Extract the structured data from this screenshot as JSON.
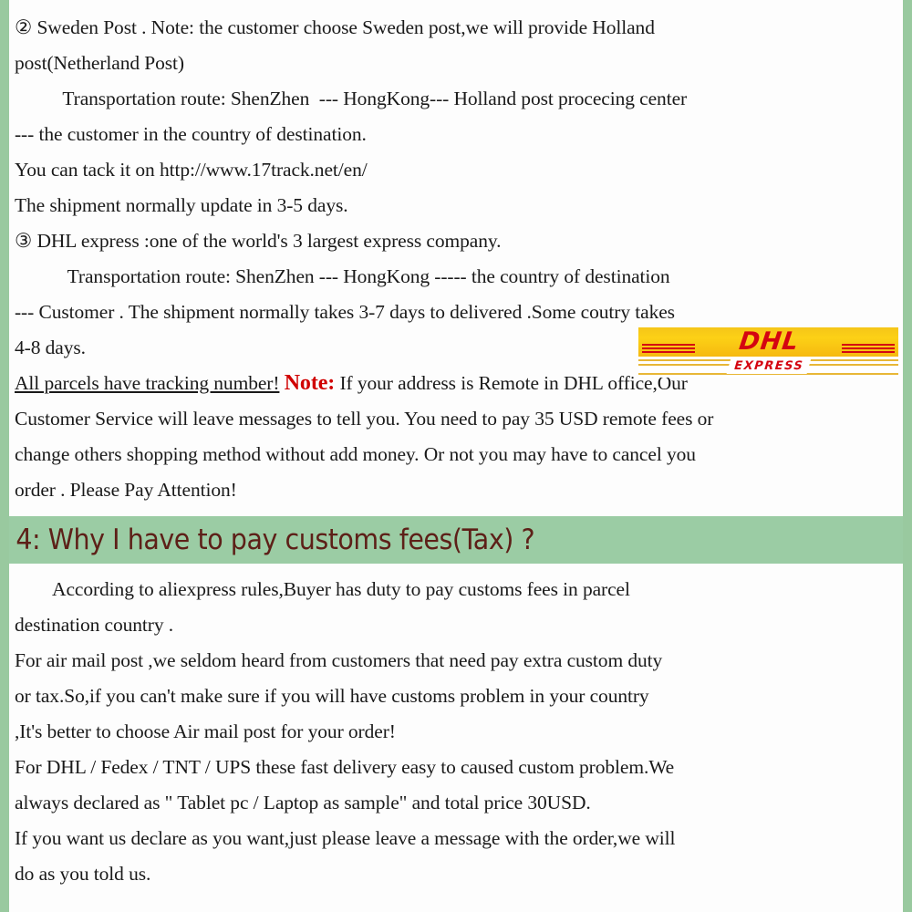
{
  "colors": {
    "page_background": "#fdfdfd",
    "side_border_green": "#99c99f",
    "heading_band_green": "#9bcca4",
    "heading_text": "#5d2018",
    "note_red": "#d00000",
    "dhl_yellow": "#fcd116",
    "dhl_red": "#d40511",
    "body_text": "#1a1a1a"
  },
  "section_shipping": {
    "sweden": {
      "line1": "② Sweden Post . Note: the customer choose Sweden post,we will provide Holland",
      "line2": "post(Netherland Post)",
      "line3": "          Transportation route: ShenZhen  --- HongKong--- Holland post procecing center",
      "line4": "--- the customer in the country of destination.",
      "line5": "You can tack it on http://www.17track.net/en/",
      "line6": "The shipment normally update in 3-5 days."
    },
    "dhl": {
      "line1": "③ DHL express :one of the world's 3 largest express company.",
      "line2": "           Transportation route: ShenZhen --- HongKong ----- the country of destination",
      "line3": "--- Customer . The shipment normally takes 3-7 days to delivered .Some coutry takes",
      "line4": "4-8 days."
    },
    "tracking_note": {
      "underlined_part": "All parcels have tracking number!",
      "note_label": "Note:",
      "note_rest": " If your address is Remote in DHL office,Our",
      "line2": "Customer Service will leave messages to tell you. You need to pay 35 USD remote fees or",
      "line3": "change others shopping method without add money. Or not you may have to cancel you",
      "line4": "order . Please Pay Attention!"
    }
  },
  "dhl_logo": {
    "wordmark": "DHL",
    "subtitle": "EXPRESS"
  },
  "section_customs": {
    "heading": "4: Why I have to pay customs fees(Tax) ?",
    "line1": "        According to aliexpress rules,Buyer has duty to pay customs fees in parcel",
    "line2": "destination country .",
    "line3": "For air mail post ,we seldom heard from customers that need pay extra custom duty",
    "line4": "or tax.So,if you can't make sure if you will have customs problem in your country",
    "line5": ",It's better to choose Air mail post for your order!",
    "line6": "For DHL / Fedex / TNT / UPS these fast delivery easy to caused custom problem.We",
    "line7": "always declared as \" Tablet pc / Laptop as sample\" and total price 30USD.",
    "line8": "If you want us declare as you want,just please leave a message with the order,we will",
    "line9": "do as you told us."
  }
}
